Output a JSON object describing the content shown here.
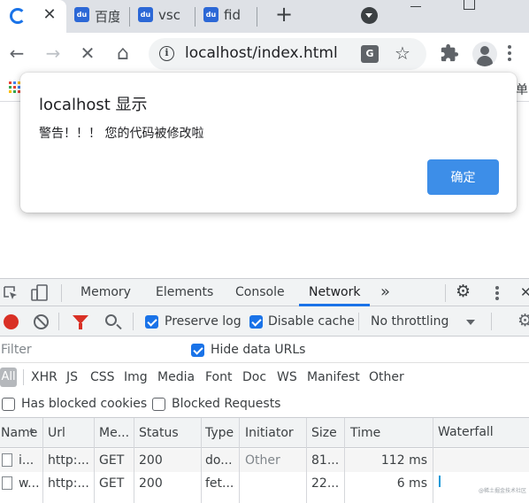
{
  "tabs": [
    {
      "title": "百度",
      "favicon": "baidu-paw-icon"
    },
    {
      "title": "vsc",
      "favicon": "baidu-paw-icon"
    },
    {
      "title": "fid",
      "favicon": "baidu-paw-icon"
    }
  ],
  "favicon_text": "du",
  "tab_close_glyph": "✕",
  "new_tab_glyph": "+",
  "toolbar": {
    "url": "localhost/index.html",
    "info_glyph": "i",
    "translate_glyph": "G",
    "star_glyph": "☆",
    "back_glyph": "←",
    "forward_glyph": "→",
    "stop_glyph": "✕",
    "home_glyph": "⌂"
  },
  "bookmarks": {
    "right_text": "单"
  },
  "dialog": {
    "title": "localhost 显示",
    "message": "警告！！！ 您的代码被修改啦",
    "ok_label": "确定"
  },
  "devtools": {
    "tabs": [
      "Memory",
      "Elements",
      "Console",
      "Network"
    ],
    "active_tab": "Network",
    "more_glyph": "»",
    "gear_glyph": "⚙",
    "close_glyph": "✕"
  },
  "network": {
    "preserve_log": {
      "label": "Preserve log",
      "checked": true
    },
    "disable_cache": {
      "label": "Disable cache",
      "checked": true
    },
    "throttling": "No throttling",
    "filter_placeholder": "Filter",
    "hide_data_urls": {
      "label": "Hide data URLs",
      "checked": true
    },
    "types": [
      "All",
      "XHR",
      "JS",
      "CSS",
      "Img",
      "Media",
      "Font",
      "Doc",
      "WS",
      "Manifest",
      "Other"
    ],
    "has_blocked_cookies": {
      "label": "Has blocked cookies",
      "checked": false
    },
    "blocked_requests": {
      "label": "Blocked Requests",
      "checked": false
    },
    "columns": [
      "Name",
      "Url",
      "Me...",
      "Status",
      "Type",
      "Initiator",
      "Size",
      "Time",
      "Waterfall"
    ],
    "sort_glyph": "▴",
    "rows": [
      {
        "name": "i...",
        "url": "http:...",
        "method": "GET",
        "status": "200",
        "type": "do...",
        "initiator": "Other",
        "size": "81...",
        "time": "112 ms"
      },
      {
        "name": "w...",
        "url": "http:...",
        "method": "GET",
        "status": "200",
        "type": "fet...",
        "initiator": "",
        "size": "22...",
        "time": "6 ms"
      }
    ],
    "watermark": "@稀土掘金技术社区"
  },
  "colors": {
    "accent": "#1a73e8",
    "dialog_button": "#3d8ee8",
    "record": "#d93025",
    "tabstrip": "#dee1e6"
  }
}
